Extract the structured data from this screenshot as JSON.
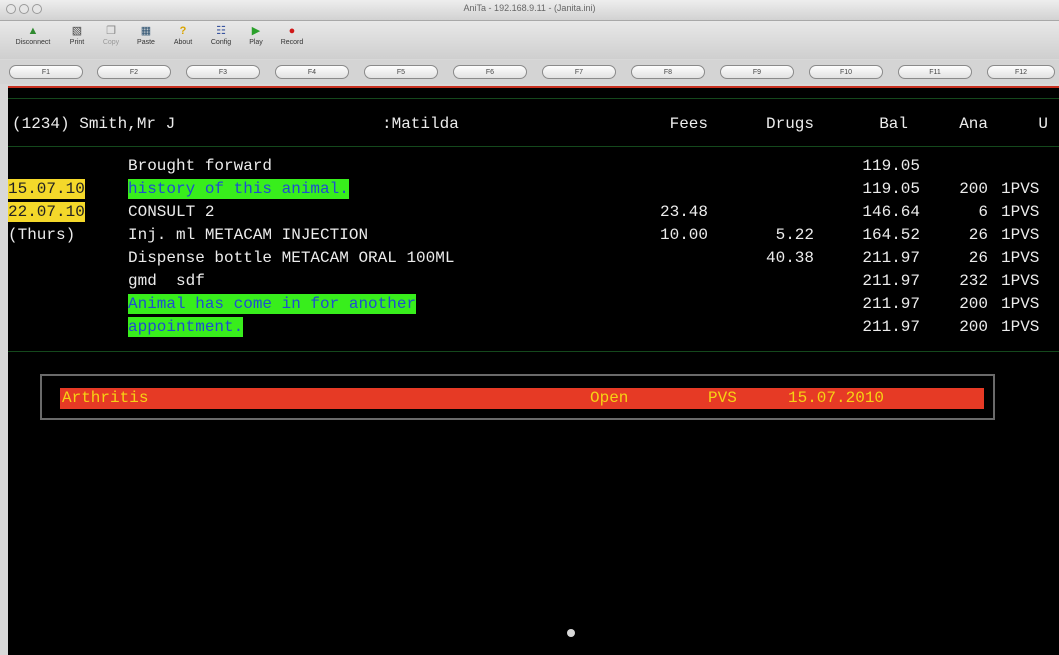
{
  "window": {
    "title": "AniTa - 192.168.9.11 - (Janita.ini)"
  },
  "toolbar": {
    "buttons": [
      {
        "label": "Disconnect",
        "icon": "disconnect-icon"
      },
      {
        "label": "Print",
        "icon": "printer-icon"
      },
      {
        "label": "Copy",
        "icon": "copy-icon"
      },
      {
        "label": "Paste",
        "icon": "paste-icon"
      },
      {
        "label": "About",
        "icon": "question-icon"
      },
      {
        "label": "Config",
        "icon": "config-icon"
      },
      {
        "label": "Play",
        "icon": "play-icon"
      },
      {
        "label": "Record",
        "icon": "record-icon"
      }
    ],
    "icon_colors": {
      "disconnect": "#2f8a2f",
      "print": "#444444",
      "copy": "#888888",
      "paste": "#2a4f6e",
      "about": "#d9a400",
      "config": "#3a55a0",
      "play": "#2aa02a",
      "record": "#d01818"
    }
  },
  "function_keys": [
    "F1",
    "F2",
    "F3",
    "F4",
    "F5",
    "F6",
    "F7",
    "F8",
    "F9",
    "F10",
    "F11",
    "F12"
  ],
  "header": {
    "patient": "(1234) Smith,Mr J",
    "animal": ":Matilda",
    "fees": "Fees",
    "drugs": "Drugs",
    "bal": "Bal",
    "ana": "Ana",
    "u": "U"
  },
  "rows": [
    {
      "date": "",
      "desc": "Brought forward",
      "fees": "",
      "drugs": "",
      "bal": "119.05",
      "ana": "",
      "u": ""
    },
    {
      "date": "15.07.10",
      "desc": "history of this animal.",
      "fees": "",
      "drugs": "",
      "bal": "119.05",
      "ana": "200",
      "u": "1PVS"
    },
    {
      "date": "22.07.10",
      "desc": "CONSULT 2",
      "fees": "23.48",
      "drugs": "",
      "bal": "146.64",
      "ana": "6",
      "u": "1PVS"
    },
    {
      "date": "(Thurs)",
      "desc": "Inj. ml METACAM INJECTION",
      "fees": "10.00",
      "drugs": "5.22",
      "bal": "164.52",
      "ana": "26",
      "u": "1PVS"
    },
    {
      "date": "",
      "desc": "Dispense bottle METACAM ORAL 100ML",
      "fees": "",
      "drugs": "40.38",
      "bal": "211.97",
      "ana": "26",
      "u": "1PVS"
    },
    {
      "date": "",
      "desc": "gmd  sdf",
      "fees": "",
      "drugs": "",
      "bal": "211.97",
      "ana": "232",
      "u": "1PVS"
    },
    {
      "date": "",
      "desc": "Animal has come in for another",
      "fees": "",
      "drugs": "",
      "bal": "211.97",
      "ana": "200",
      "u": "1PVS"
    },
    {
      "date": "",
      "desc": "appointment.",
      "fees": "",
      "drugs": "",
      "bal": "211.97",
      "ana": "200",
      "u": "1PVS"
    }
  ],
  "problem": {
    "name": "Arthritis",
    "status": "Open",
    "vet": "PVS",
    "date": "15.07.2010"
  },
  "colors": {
    "background": "#000000",
    "text": "#ececec",
    "date_highlight": "#f4d82a",
    "note_highlight": "#38ee1c",
    "note_text": "#1e4fd0",
    "problem_bar": "#e63a25",
    "problem_text": "#f6d214"
  }
}
